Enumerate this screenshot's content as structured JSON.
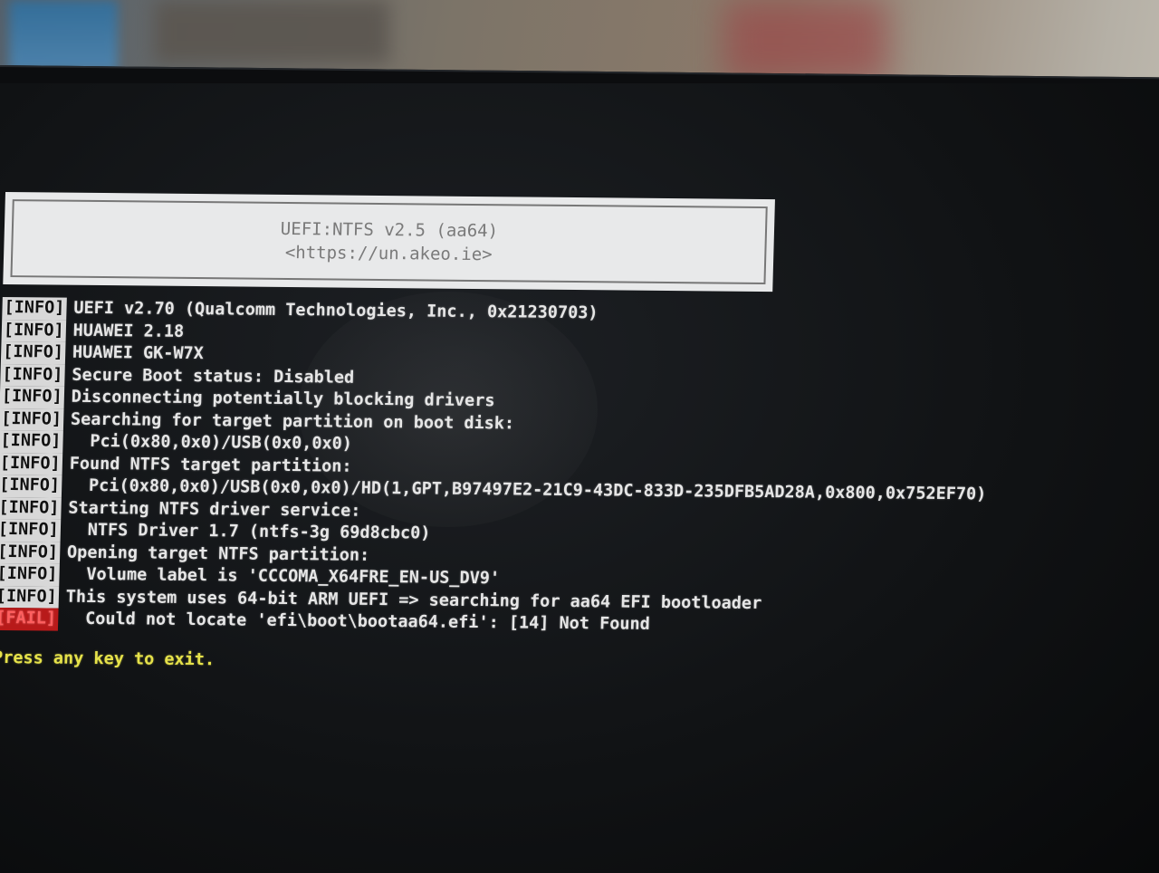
{
  "banner": {
    "title": "UEFI:NTFS v2.5 (aa64)",
    "url": "<https://un.akeo.ie>"
  },
  "log": [
    {
      "tag": "[INFO]",
      "level": "info",
      "text": "UEFI v2.70 (Qualcomm Technologies, Inc., 0x21230703)",
      "indent": false
    },
    {
      "tag": "[INFO]",
      "level": "info",
      "text": "HUAWEI 2.18",
      "indent": false
    },
    {
      "tag": "[INFO]",
      "level": "info",
      "text": "HUAWEI GK-W7X",
      "indent": false
    },
    {
      "tag": "[INFO]",
      "level": "info",
      "text": "Secure Boot status: Disabled",
      "indent": false
    },
    {
      "tag": "[INFO]",
      "level": "info",
      "text": "Disconnecting potentially blocking drivers",
      "indent": false
    },
    {
      "tag": "[INFO]",
      "level": "info",
      "text": "Searching for target partition on boot disk:",
      "indent": false
    },
    {
      "tag": "[INFO]",
      "level": "info",
      "text": "Pci(0x80,0x0)/USB(0x0,0x0)",
      "indent": true
    },
    {
      "tag": "[INFO]",
      "level": "info",
      "text": "Found NTFS target partition:",
      "indent": false
    },
    {
      "tag": "[INFO]",
      "level": "info",
      "text": "Pci(0x80,0x0)/USB(0x0,0x0)/HD(1,GPT,B97497E2-21C9-43DC-833D-235DFB5AD28A,0x800,0x752EF70)",
      "indent": true
    },
    {
      "tag": "[INFO]",
      "level": "info",
      "text": "Starting NTFS driver service:",
      "indent": false
    },
    {
      "tag": "[INFO]",
      "level": "info",
      "text": "NTFS Driver 1.7 (ntfs-3g 69d8cbc0)",
      "indent": true
    },
    {
      "tag": "[INFO]",
      "level": "info",
      "text": "Opening target NTFS partition:",
      "indent": false
    },
    {
      "tag": "[INFO]",
      "level": "info",
      "text": "Volume label is 'CCCOMA_X64FRE_EN-US_DV9'",
      "indent": true
    },
    {
      "tag": "[INFO]",
      "level": "info",
      "text": "This system uses 64-bit ARM UEFI => searching for aa64 EFI bootloader",
      "indent": false
    },
    {
      "tag": "[FAIL]",
      "level": "fail",
      "text": "Could not locate 'efi\\boot\\bootaa64.efi': [14] Not Found",
      "indent": true
    }
  ],
  "prompt": "Press any key to exit.",
  "colors": {
    "info_text": "#e6e6e6",
    "fail_tag": "#b81a1a",
    "prompt": "#e6e24a",
    "banner_bg": "#e8e9ea"
  }
}
